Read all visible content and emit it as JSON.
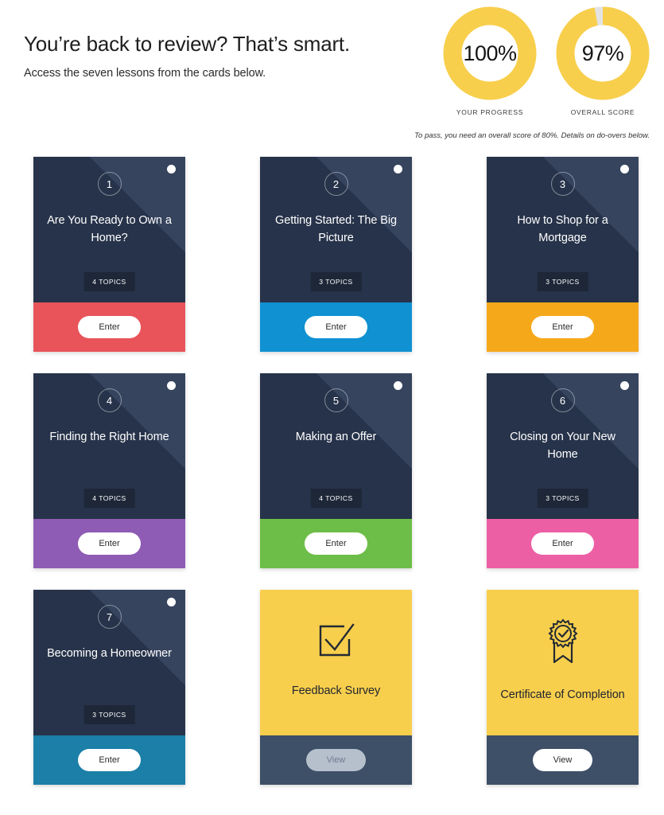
{
  "header": {
    "headline": "You’re back to review? That’s smart.",
    "subhead": "Access the seven lessons from the cards below.",
    "pass_note": "To pass, you need an overall score of 80%. Details on do-overs below."
  },
  "gauges": [
    {
      "value": "100%",
      "label": "YOUR PROGRESS",
      "percent": 100,
      "color": "#f8cf4c",
      "track": "#ffffff"
    },
    {
      "value": "97%",
      "label": "OVERALL SCORE",
      "percent": 97,
      "color": "#f8cf4c",
      "track": "#e3e3e3"
    }
  ],
  "cards": [
    {
      "number": "1",
      "title": "Are You Ready to Own a Home?",
      "topics": "4 TOPICS",
      "button": "Enter",
      "accent": "#e8545a",
      "type": "lesson",
      "status": "complete"
    },
    {
      "number": "2",
      "title": "Getting Started: The Big Picture",
      "topics": "3 TOPICS",
      "button": "Enter",
      "accent": "#0f91d2",
      "type": "lesson",
      "status": "complete"
    },
    {
      "number": "3",
      "title": "How to Shop for a Mortgage",
      "topics": "3 TOPICS",
      "button": "Enter",
      "accent": "#f6a81b",
      "type": "lesson",
      "status": "complete"
    },
    {
      "number": "4",
      "title": "Finding the Right Home",
      "topics": "4 TOPICS",
      "button": "Enter",
      "accent": "#8e5bb5",
      "type": "lesson",
      "status": "complete"
    },
    {
      "number": "5",
      "title": "Making an Offer",
      "topics": "4 TOPICS",
      "button": "Enter",
      "accent": "#6dbe48",
      "type": "lesson",
      "status": "complete"
    },
    {
      "number": "6",
      "title": "Closing on Your New Home",
      "topics": "3 TOPICS",
      "button": "Enter",
      "accent": "#ed5fa5",
      "type": "lesson",
      "status": "complete"
    },
    {
      "number": "7",
      "title": "Becoming a Homeowner",
      "topics": "3 TOPICS",
      "button": "Enter",
      "accent": "#1b7fa8",
      "type": "lesson",
      "status": "complete"
    },
    {
      "number": "",
      "title": "Feedback Survey",
      "topics": "",
      "button": "View",
      "accent": "#3e5067",
      "type": "survey",
      "icon": "checkbox-check-icon",
      "status": "disabled"
    },
    {
      "number": "",
      "title": "Certificate of Completion",
      "topics": "",
      "button": "View",
      "accent": "#3e5067",
      "type": "certificate",
      "icon": "award-ribbon-icon",
      "status": "available"
    }
  ]
}
